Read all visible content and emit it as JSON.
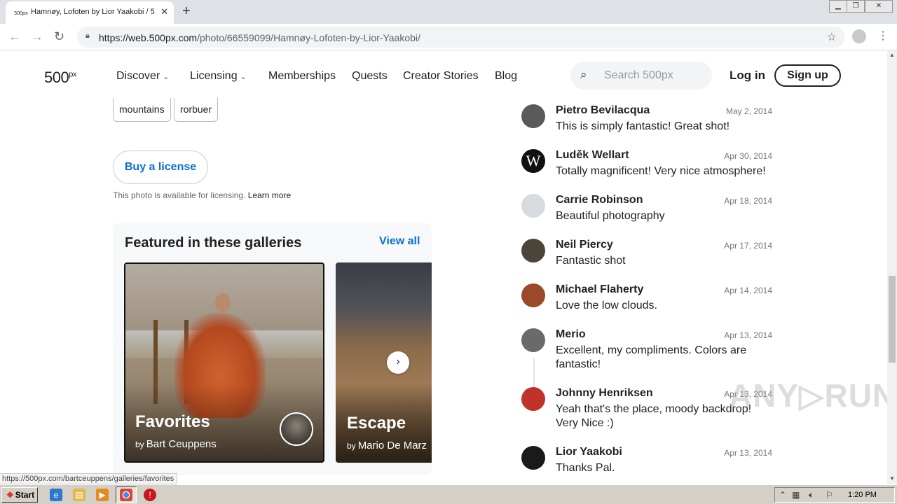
{
  "browser": {
    "tab_favicon": "500px",
    "tab_title": "Hamnøy, Lofoten by Lior Yaakobi / 5",
    "url_host": "https://web.500px.com",
    "url_path": "/photo/66559099/Hamnøy-Lofoten-by-Lior-Yaakobi/"
  },
  "nav": {
    "logo": "500",
    "logo_suffix": "px",
    "items": [
      "Discover",
      "Licensing",
      "Memberships",
      "Quests",
      "Creator Stories",
      "Blog"
    ],
    "search_placeholder": "Search 500px",
    "login": "Log in",
    "signup": "Sign up"
  },
  "tags": [
    "mountains",
    "rorbuer"
  ],
  "license": {
    "buy_label": "Buy a license",
    "note": "This photo is available for licensing.",
    "learn_more": "Learn more"
  },
  "galleries": {
    "title": "Featured in these galleries",
    "view_all": "View all",
    "items": [
      {
        "name": "Favorites",
        "by": "by",
        "author": "Bart Ceuppens"
      },
      {
        "name": "Escape",
        "by": "by",
        "author": "Mario De Marz"
      }
    ]
  },
  "comments": [
    {
      "name": "Pietro Bevilacqua",
      "date": "May 2, 2014",
      "text": "This is simply fantastic! Great shot!",
      "avatar_color": "#5a5a5a"
    },
    {
      "name": "Luděk Wellart",
      "date": "Apr 30, 2014",
      "text": "Totally magnificent! Very nice atmosphere!",
      "avatar_letter": "W",
      "avatar_color": "#111111"
    },
    {
      "name": "Carrie Robinson",
      "date": "Apr 18, 2014",
      "text": "Beautiful photography",
      "avatar_color": "#d7dbdf"
    },
    {
      "name": "Neil Piercy",
      "date": "Apr 17, 2014",
      "text": "Fantastic shot",
      "avatar_color": "#4b4538"
    },
    {
      "name": "Michael Flaherty",
      "date": "Apr 14, 2014",
      "text": "Love the low clouds.",
      "avatar_color": "#9a4a2a"
    },
    {
      "name": "Merio",
      "date": "Apr 13, 2014",
      "text": "Excellent, my compliments. Colors are fantastic!",
      "avatar_color": "#6a6a6a"
    },
    {
      "name": "Johnny Henriksen",
      "date": "Apr 13, 2014",
      "text": "Yeah that's the place, moody backdrop! Very Nice :)",
      "avatar_color": "#c0322a"
    },
    {
      "name": "Lior Yaakobi",
      "date": "Apr 13, 2014",
      "text": "Thanks Pal.",
      "avatar_color": "#1a1a1a"
    }
  ],
  "status_url": "https://500px.com/bartceuppens/galleries/favorites",
  "watermark": "ANY RUN",
  "taskbar": {
    "start": "Start",
    "clock": "1:20 PM"
  }
}
